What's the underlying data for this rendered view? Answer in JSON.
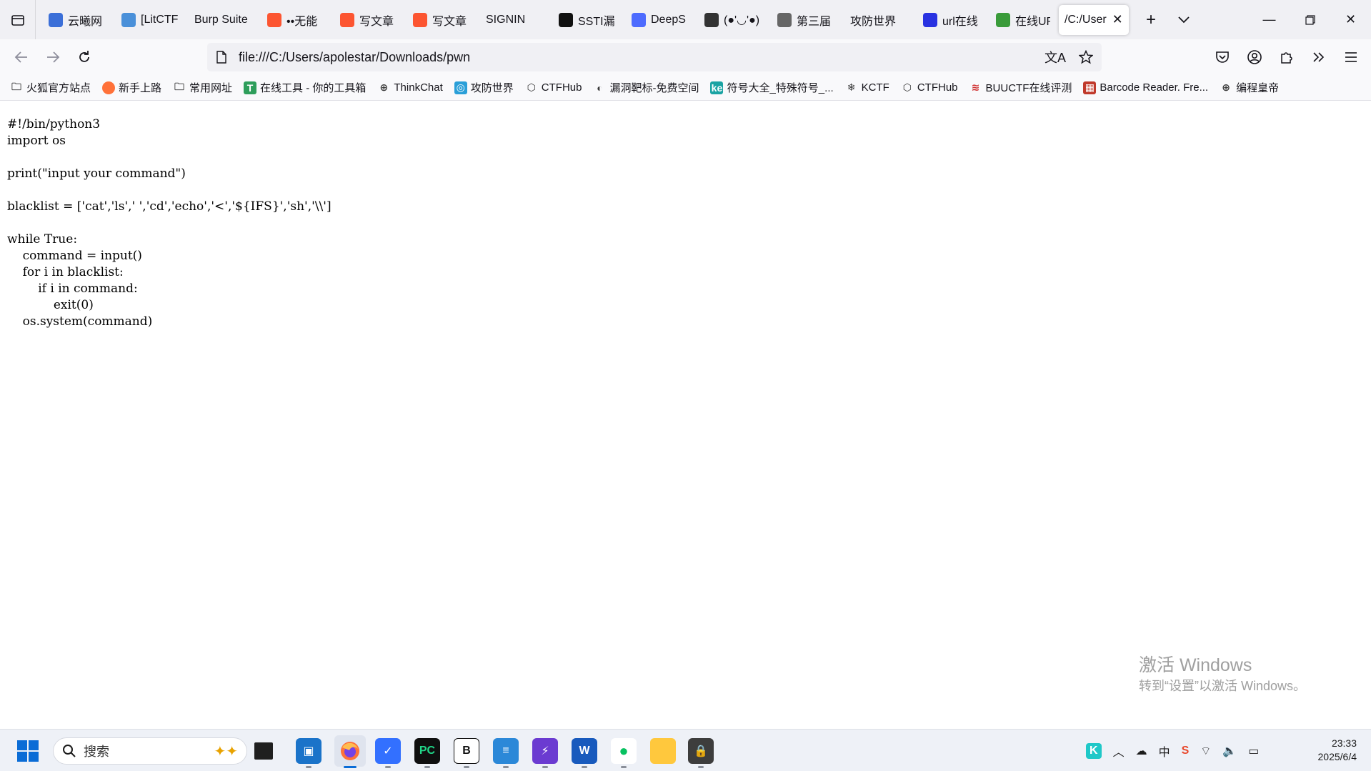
{
  "tabs": [
    {
      "label": "云曦网",
      "icon": "cloud-site-icon",
      "color": "#3b6fd8"
    },
    {
      "label": "[LitCTF",
      "icon": "litctf-icon",
      "color": "#4a90d9"
    },
    {
      "label": "Burp Suite",
      "icon": "",
      "color": ""
    },
    {
      "label": "••无能",
      "icon": "csdn-icon",
      "color": "#fc5531"
    },
    {
      "label": "写文章",
      "icon": "csdn-icon",
      "color": "#fc5531"
    },
    {
      "label": "写文章",
      "icon": "csdn-icon",
      "color": "#fc5531"
    },
    {
      "label": "SIGNIN",
      "icon": "",
      "color": ""
    },
    {
      "label": "SSTI漏",
      "icon": "k-icon",
      "color": "#111111"
    },
    {
      "label": "DeepS",
      "icon": "deepseek-icon",
      "color": "#4d6bfe"
    },
    {
      "label": "(●'◡'●)",
      "icon": "avatar-icon",
      "color": "#333333"
    },
    {
      "label": "第三届",
      "icon": "mic-icon",
      "color": "#666666"
    },
    {
      "label": "攻防世界",
      "icon": "",
      "color": ""
    },
    {
      "label": "url在线",
      "icon": "baidu-icon",
      "color": "#2932e1"
    },
    {
      "label": "在线UR",
      "icon": "frog-icon",
      "color": "#3a9b3a"
    }
  ],
  "active_tab": {
    "label": "/C:/User"
  },
  "url": "file:///C:/Users/apolestar/Downloads/pwn",
  "bookmarks": [
    {
      "label": "火狐官方站点",
      "icon": "folder-icon"
    },
    {
      "label": "新手上路",
      "icon": "firefox-icon"
    },
    {
      "label": "常用网址",
      "icon": "folder-icon"
    },
    {
      "label": "在线工具 - 你的工具箱",
      "icon": "tool-icon"
    },
    {
      "label": "ThinkChat",
      "icon": "globe-icon"
    },
    {
      "label": "攻防世界",
      "icon": "adworld-icon"
    },
    {
      "label": "CTFHub",
      "icon": "cube-icon"
    },
    {
      "label": "漏洞靶标-免费空间",
      "icon": "bug-icon"
    },
    {
      "label": "符号大全_特殊符号_...",
      "icon": "ke-icon"
    },
    {
      "label": "KCTF",
      "icon": "snowflake-icon"
    },
    {
      "label": "CTFHub",
      "icon": "cube-icon"
    },
    {
      "label": "BUUCTF在线评测",
      "icon": "buu-icon"
    },
    {
      "label": "Barcode Reader. Fre...",
      "icon": "barcode-icon"
    },
    {
      "label": "编程皇帝",
      "icon": "globe-icon"
    }
  ],
  "code": "#!/bin/python3\nimport os\n\nprint(\"input your command\")\n\nblacklist = ['cat','ls',' ','cd','echo','<','${IFS}','sh','\\\\']\n\nwhile True:\n    command = input()\n    for i in blacklist:\n        if i in command:\n            exit(0)\n    os.system(command)",
  "watermark": {
    "line1": "激活 Windows",
    "line2": "转到“设置”以激活 Windows。"
  },
  "taskbar": {
    "search_placeholder": "搜索",
    "time": "23:33",
    "date": "2025/6/4",
    "ime": "中"
  }
}
